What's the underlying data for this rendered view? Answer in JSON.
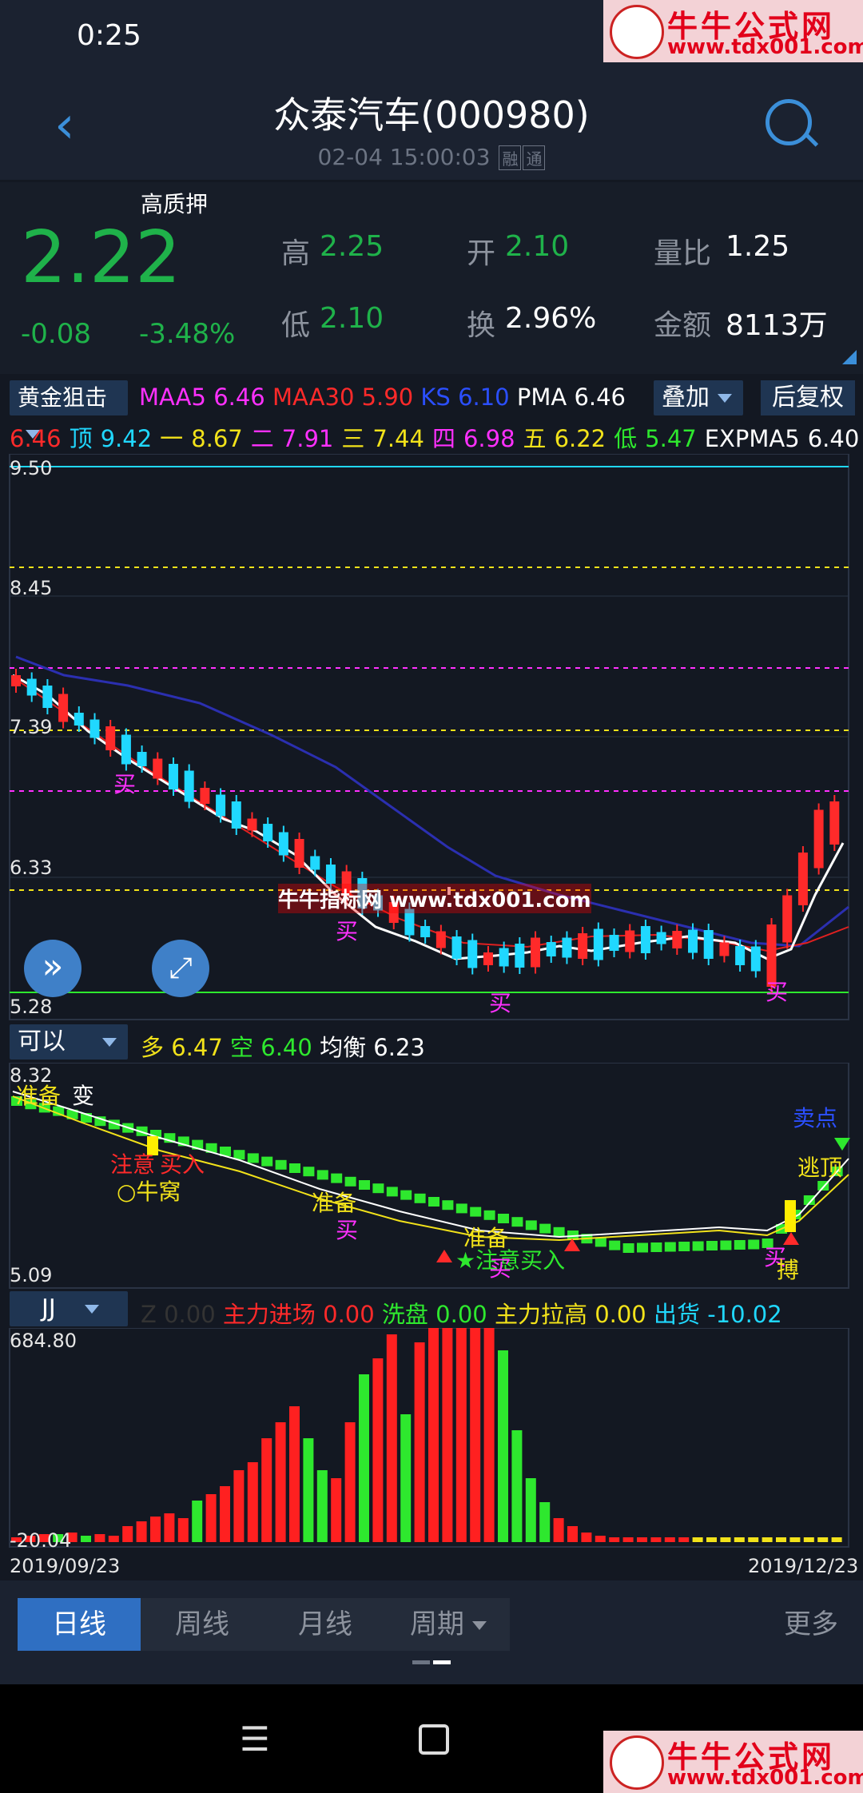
{
  "status": {
    "time": "0:25"
  },
  "watermark": {
    "line1": "牛牛公式网",
    "line2": "www.tdx001.com",
    "chart_text": "牛牛指标网 www.tdx001.com"
  },
  "header": {
    "title": "众泰汽车(000980)",
    "datetime": "02-04 15:00:03",
    "tag1": "融",
    "tag2": "通"
  },
  "quote": {
    "badge": "高质押",
    "price": "2.22",
    "change": "-0.08",
    "change_pct": "-3.48%",
    "high_label": "高",
    "high": "2.25",
    "open_label": "开",
    "open": "2.10",
    "vol_ratio_label": "量比",
    "vol_ratio": "1.25",
    "low_label": "低",
    "low": "2.10",
    "turnover_label": "换",
    "turnover": "2.96%",
    "amount_label": "金额",
    "amount": "8113万"
  },
  "main_indicator": {
    "selector": "黄金狙击",
    "maa5_label": "MAA5",
    "maa5": "6.46",
    "maa30_label": "MAA30",
    "maa30": "5.90",
    "ks_label": "KS",
    "ks": "6.10",
    "pma_label": "PMA",
    "pma": "6.46",
    "overlay_btn": "叠加",
    "adjust_btn": "后复权",
    "row2": [
      {
        "t": "6.46",
        "c": "#ff2a2a"
      },
      {
        "t": "顶",
        "c": "#20d8ff"
      },
      {
        "t": "9.42",
        "c": "#20d8ff"
      },
      {
        "t": "一",
        "c": "#f2e21a"
      },
      {
        "t": "8.67",
        "c": "#f2e21a"
      },
      {
        "t": "二",
        "c": "#ff30ff"
      },
      {
        "t": "7.91",
        "c": "#ff30ff"
      },
      {
        "t": "三",
        "c": "#f2e21a"
      },
      {
        "t": "7.44",
        "c": "#f2e21a"
      },
      {
        "t": "四",
        "c": "#ff30ff"
      },
      {
        "t": "6.98",
        "c": "#ff30ff"
      },
      {
        "t": "五",
        "c": "#f2e21a"
      },
      {
        "t": "6.22",
        "c": "#f2e21a"
      },
      {
        "t": "低",
        "c": "#2ee82e"
      },
      {
        "t": "5.47",
        "c": "#2ee82e"
      },
      {
        "t": "EXPMA5",
        "c": "#ffffff"
      },
      {
        "t": "6.40",
        "c": "#ffffff"
      }
    ],
    "axis": [
      "9.50",
      "8.45",
      "7.39",
      "6.33",
      "5.28"
    ],
    "buy_signal": "买"
  },
  "sub1": {
    "selector": "可以",
    "duo_label": "多",
    "duo": "6.47",
    "kong_label": "空",
    "kong": "6.40",
    "jh_label": "均衡",
    "jh": "6.23",
    "axis_top": "8.32",
    "axis_bottom": "5.09",
    "labels": [
      "准备",
      "变",
      "注意",
      "买入",
      "○牛窝",
      "准备",
      "买",
      "准备",
      "★注意买入",
      "买",
      "卖点",
      "逃顶",
      "买",
      "搏"
    ]
  },
  "sub2": {
    "selector": "JJ",
    "z_label": "Z",
    "z": "0.00",
    "zljc_label": "主力进场",
    "zljc": "0.00",
    "xp_label": "洗盘",
    "xp": "0.00",
    "zllg_label": "主力拉高",
    "zllg": "0.00",
    "ch_label": "出货",
    "ch": "-10.02",
    "axis_top": "684.80",
    "axis_bottom": "-20.04",
    "date_start": "2019/09/23",
    "date_end": "2019/12/23"
  },
  "tabs": {
    "daily": "日线",
    "weekly": "周线",
    "monthly": "月线",
    "period": "周期",
    "more": "更多"
  },
  "colors": {
    "bg": "#131822",
    "up": "#ff2a2a",
    "down": "#20d8ff",
    "green": "#1fb24a",
    "accent": "#2f6fc2"
  }
}
